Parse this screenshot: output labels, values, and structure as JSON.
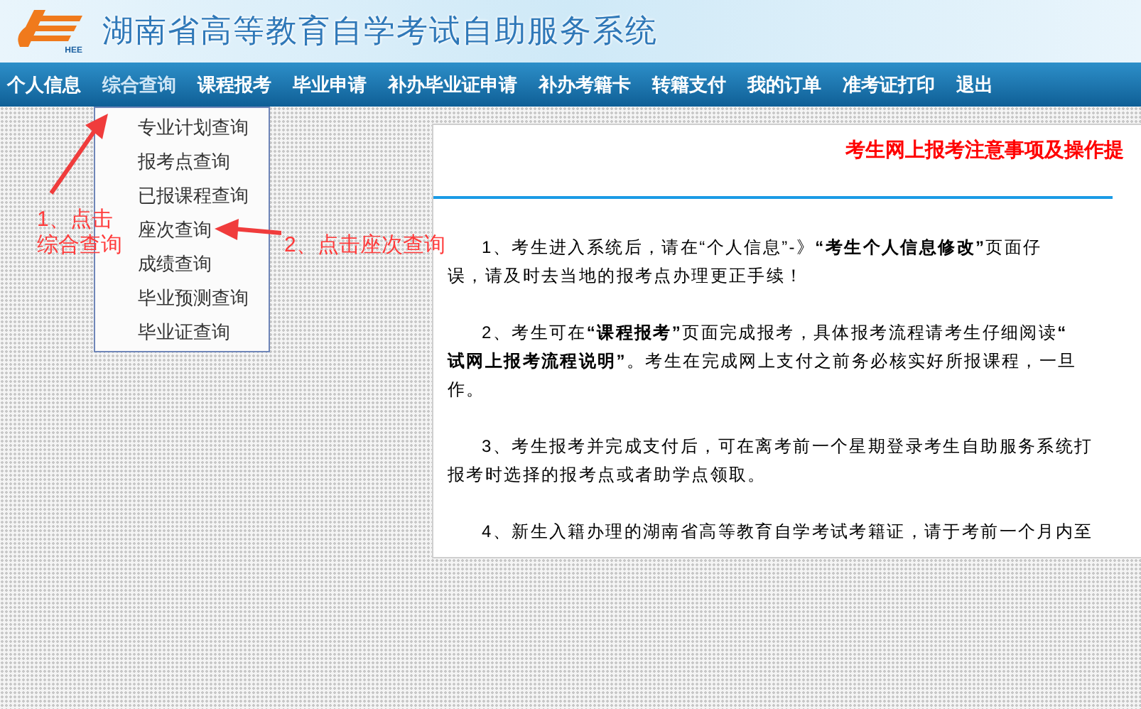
{
  "header": {
    "logo_text": "HEE",
    "title": "湖南省高等教育自学考试自助服务系统"
  },
  "menu": [
    {
      "label": "个人信息",
      "selected": false
    },
    {
      "label": "综合查询",
      "selected": true
    },
    {
      "label": "课程报考",
      "selected": false
    },
    {
      "label": "毕业申请",
      "selected": false
    },
    {
      "label": "补办毕业证申请",
      "selected": false
    },
    {
      "label": "补办考籍卡",
      "selected": false
    },
    {
      "label": "转籍支付",
      "selected": false
    },
    {
      "label": "我的订单",
      "selected": false
    },
    {
      "label": "准考证打印",
      "selected": false
    },
    {
      "label": "退出",
      "selected": false
    }
  ],
  "dropdown": [
    {
      "label": "专业计划查询"
    },
    {
      "label": "报考点查询"
    },
    {
      "label": "已报课程查询"
    },
    {
      "label": "座次查询"
    },
    {
      "label": "成绩查询"
    },
    {
      "label": "毕业预测查询"
    },
    {
      "label": "毕业证查询"
    }
  ],
  "notice": {
    "title": "考生网上报考注意事项及操作提",
    "paragraphs": [
      {
        "lines": [
          "1、考生进入系统后，请在“个人信息”-》**“考生个人信息修改”**页面仔",
          "误，请及时去当地的报考点办理更正手续！"
        ]
      },
      {
        "lines": [
          "2、考生可在**“课程报考”**页面完成报考，具体报考流程请考生仔细阅读**“**",
          "**试网上报考流程说明”**。考生在完成网上支付之前务必核实好所报课程，一旦",
          "作。"
        ]
      },
      {
        "lines": [
          "3、考生报考并完成支付后，可在离考前一个星期登录考生自助服务系统打",
          "报考时选择的报考点或者助学点领取。"
        ]
      },
      {
        "lines": [
          "4、新生入籍办理的湖南省高等教育自学考试考籍证，请于考前一个月内至"
        ]
      }
    ]
  },
  "annotations": [
    {
      "lines": [
        "1、点击",
        "综合查询"
      ]
    },
    {
      "lines": [
        "2、点击座次查询"
      ]
    }
  ]
}
